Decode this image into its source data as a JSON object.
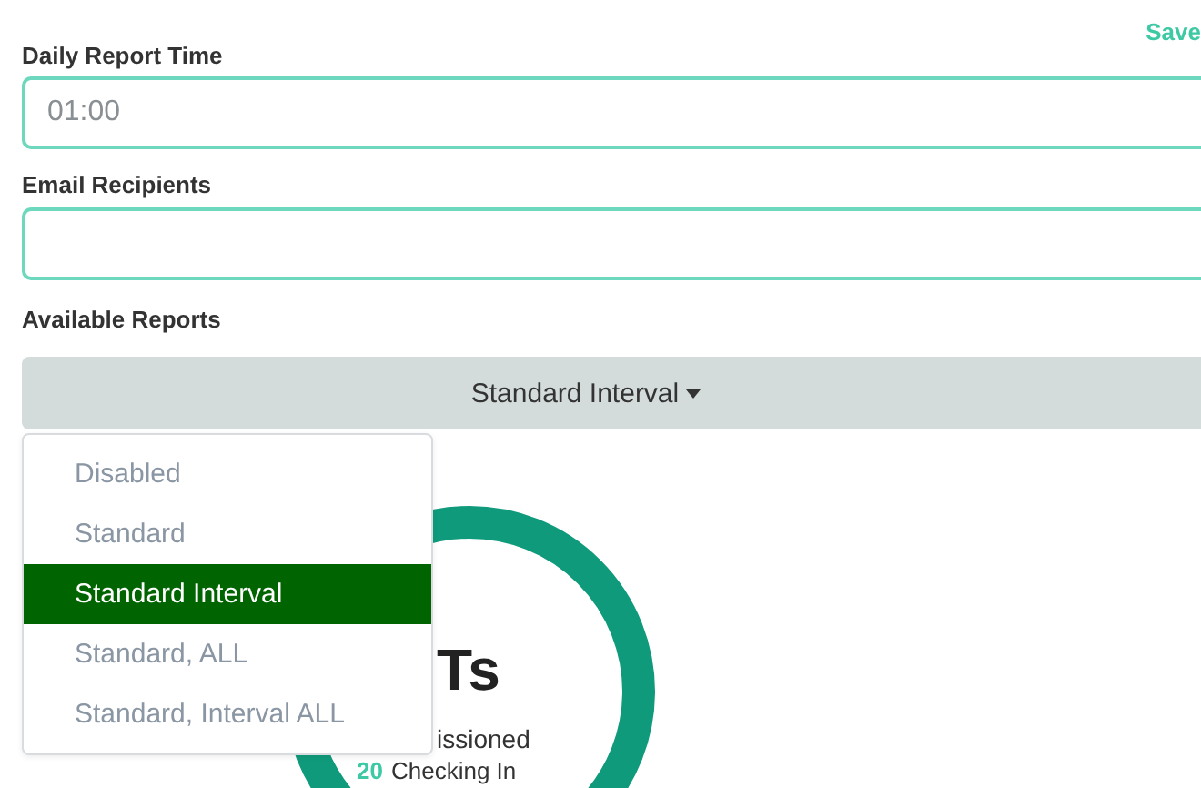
{
  "save_link": "Save",
  "daily_report_time": {
    "label": "Daily Report Time",
    "value": "01:00"
  },
  "email_recipients": {
    "label": "Email Recipients"
  },
  "available_reports": {
    "label": "Available Reports",
    "button": "Standard Interval",
    "expanded": true,
    "options": [
      {
        "label": "Disabled",
        "selected": false
      },
      {
        "label": "Standard",
        "selected": false
      },
      {
        "label": "Standard Interval",
        "selected": true
      },
      {
        "label": "Standard, ALL",
        "selected": false
      },
      {
        "label": "Standard, Interval ALL",
        "selected": false
      }
    ]
  },
  "summary": {
    "title": "Ts",
    "line_1": "issioned",
    "line_2_count": "20",
    "line_2_text": "Checking In"
  }
}
